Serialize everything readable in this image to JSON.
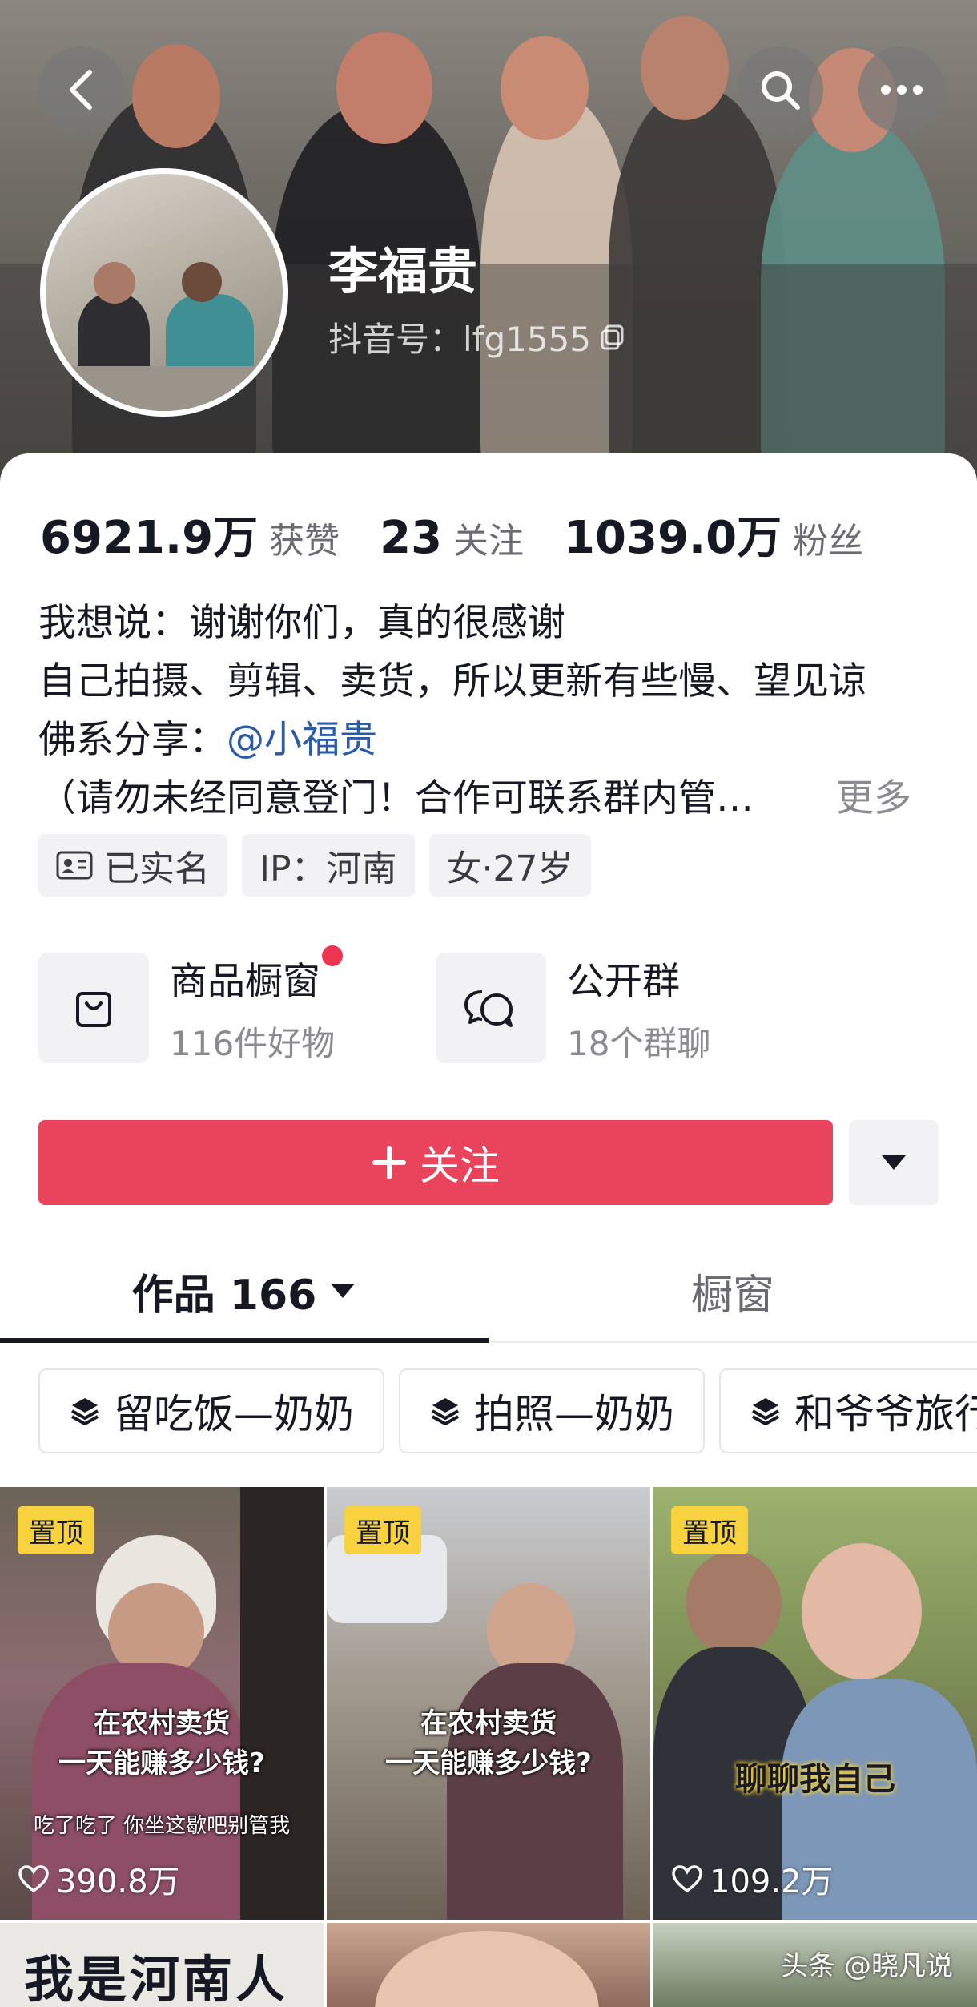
{
  "profile": {
    "nickname": "李福贵",
    "douyin_id": "抖音号：lfg1555"
  },
  "stats": {
    "likes_value": "6921.9万",
    "likes_label": "获赞",
    "following_value": "23",
    "following_label": "关注",
    "followers_value": "1039.0万",
    "followers_label": "粉丝"
  },
  "bio": {
    "line1": "我想说：谢谢你们，真的很感谢",
    "line2": "自己拍摄、剪辑、卖货，所以更新有些慢、望见谅",
    "line3_prefix": "佛系分享：",
    "line3_mention": "@小福贵",
    "line4": "（请勿未经同意登门！合作可联系群内管…",
    "more": "更多"
  },
  "tags": {
    "verified": "已实名",
    "ip": "IP：河南",
    "gender_age": "女·27岁"
  },
  "features": {
    "shop_title": "商品橱窗",
    "shop_sub": "116件好物",
    "group_title": "公开群",
    "group_sub": "18个群聊"
  },
  "actions": {
    "follow_label": "关注"
  },
  "tabs": {
    "works_label": "作品 166",
    "showcase_label": "橱窗"
  },
  "collections": [
    {
      "label": "留吃饭—奶奶"
    },
    {
      "label": "拍照—奶奶"
    },
    {
      "label": "和爷爷旅行"
    }
  ],
  "videos": [
    {
      "badge": "置顶",
      "overlay_line1": "在农村卖货",
      "overlay_line2": "一天能赚多少钱?",
      "caption": "吃了吃了 你坐这歇吧别管我",
      "likes": "390.8万"
    },
    {
      "badge": "置顶",
      "overlay_line1": "在农村卖货",
      "overlay_line2": "一天能赚多少钱?",
      "likes": ""
    },
    {
      "badge": "置顶",
      "overlay_line1": "聊聊我自己",
      "likes": "109.2万"
    }
  ],
  "bottom_row": {
    "sign_text": "我是河南人"
  },
  "watermark": "头条 @晓凡说",
  "colors": {
    "accent_red": "#e9445b",
    "badge_yellow": "#f7d23e",
    "mention_blue": "#2b5aa8"
  }
}
